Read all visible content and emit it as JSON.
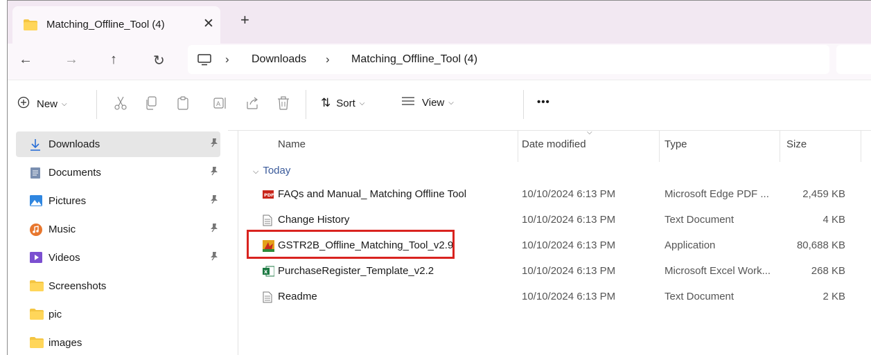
{
  "window": {
    "tab_title": "Matching_Offline_Tool (4)",
    "close_glyph": "✕",
    "new_tab_glyph": "+"
  },
  "nav": {
    "back_glyph": "←",
    "forward_glyph": "→",
    "up_glyph": "↑",
    "refresh_glyph": "↻",
    "breadcrumb": [
      "Downloads",
      "Matching_Offline_Tool (4)"
    ],
    "separator": "›"
  },
  "toolbar": {
    "new_label": "New",
    "sort_label": "Sort",
    "view_label": "View",
    "more_glyph": "•••",
    "chevron": "⌵"
  },
  "sidebar": {
    "items": [
      {
        "label": "Downloads",
        "icon": "download-arrow-icon",
        "pinned": true,
        "selected": true
      },
      {
        "label": "Documents",
        "icon": "documents-icon",
        "pinned": true
      },
      {
        "label": "Pictures",
        "icon": "pictures-icon",
        "pinned": true
      },
      {
        "label": "Music",
        "icon": "music-icon",
        "pinned": true
      },
      {
        "label": "Videos",
        "icon": "videos-icon",
        "pinned": true
      },
      {
        "label": "Screenshots",
        "icon": "folder-icon",
        "pinned": false
      },
      {
        "label": "pic",
        "icon": "folder-icon",
        "pinned": false
      },
      {
        "label": "images",
        "icon": "folder-icon",
        "pinned": false
      }
    ],
    "pin_glyph": "📌"
  },
  "list": {
    "columns": {
      "name": "Name",
      "date": "Date modified",
      "type": "Type",
      "size": "Size"
    },
    "group_label": "Today",
    "files": [
      {
        "name": "FAQs and Manual_ Matching Offline Tool",
        "date": "10/10/2024 6:13 PM",
        "type": "Microsoft Edge PDF ...",
        "size": "2,459 KB",
        "icon": "pdf-icon"
      },
      {
        "name": "Change History",
        "date": "10/10/2024 6:13 PM",
        "type": "Text Document",
        "size": "4 KB",
        "icon": "text-file-icon"
      },
      {
        "name": "GSTR2B_Offline_Matching_Tool_v2.9",
        "date": "10/10/2024 6:13 PM",
        "type": "Application",
        "size": "80,688 KB",
        "icon": "application-icon"
      },
      {
        "name": "PurchaseRegister_Template_v2.2",
        "date": "10/10/2024 6:13 PM",
        "type": "Microsoft Excel Work...",
        "size": "268 KB",
        "icon": "excel-icon"
      },
      {
        "name": "Readme",
        "date": "10/10/2024 6:13 PM",
        "type": "Text Document",
        "size": "2 KB",
        "icon": "text-file-icon"
      }
    ],
    "highlight_color": "#d9231f"
  }
}
